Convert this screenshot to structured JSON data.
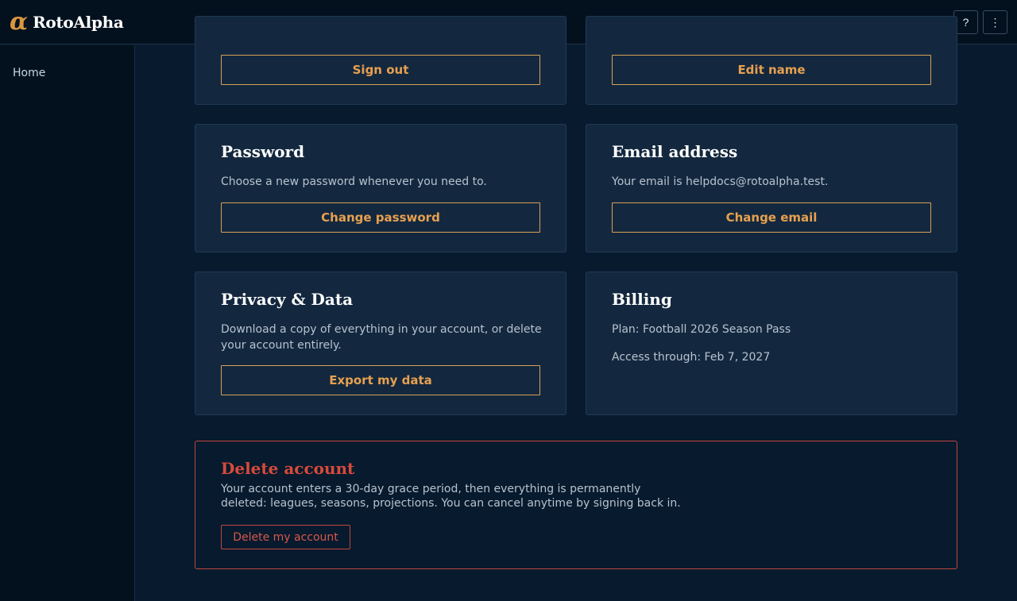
{
  "app": {
    "logo_mark": "α",
    "name": "RotoAlpha"
  },
  "header": {
    "help_label": "?",
    "menu_label": "⋮"
  },
  "sidebar": {
    "items": [
      {
        "label": "Home"
      }
    ]
  },
  "cards": {
    "account": {
      "button": "Sign out"
    },
    "name": {
      "button": "Edit name"
    },
    "password": {
      "title": "Password",
      "desc": "Choose a new password whenever you need to.",
      "button": "Change password"
    },
    "email": {
      "title": "Email address",
      "desc": "Your email is helpdocs@rotoalpha.test.",
      "button": "Change email"
    },
    "privacy": {
      "title": "Privacy & Data",
      "desc": "Download a copy of everything in your account, or delete your account entirely.",
      "button": "Export my data"
    },
    "billing": {
      "title": "Billing",
      "plan": "Plan: Football 2026 Season Pass",
      "access": "Access through: Feb 7, 2027"
    }
  },
  "danger": {
    "title": "Delete account",
    "desc": "Your account enters a 30-day grace period, then everything is permanently deleted: leagues, seasons, projections. You can cancel anytime by signing back in.",
    "button": "Delete my account"
  },
  "colors": {
    "accent": "#e7a04f",
    "danger": "#d84a3a",
    "background": "#071a2e",
    "card": "#13283f"
  }
}
